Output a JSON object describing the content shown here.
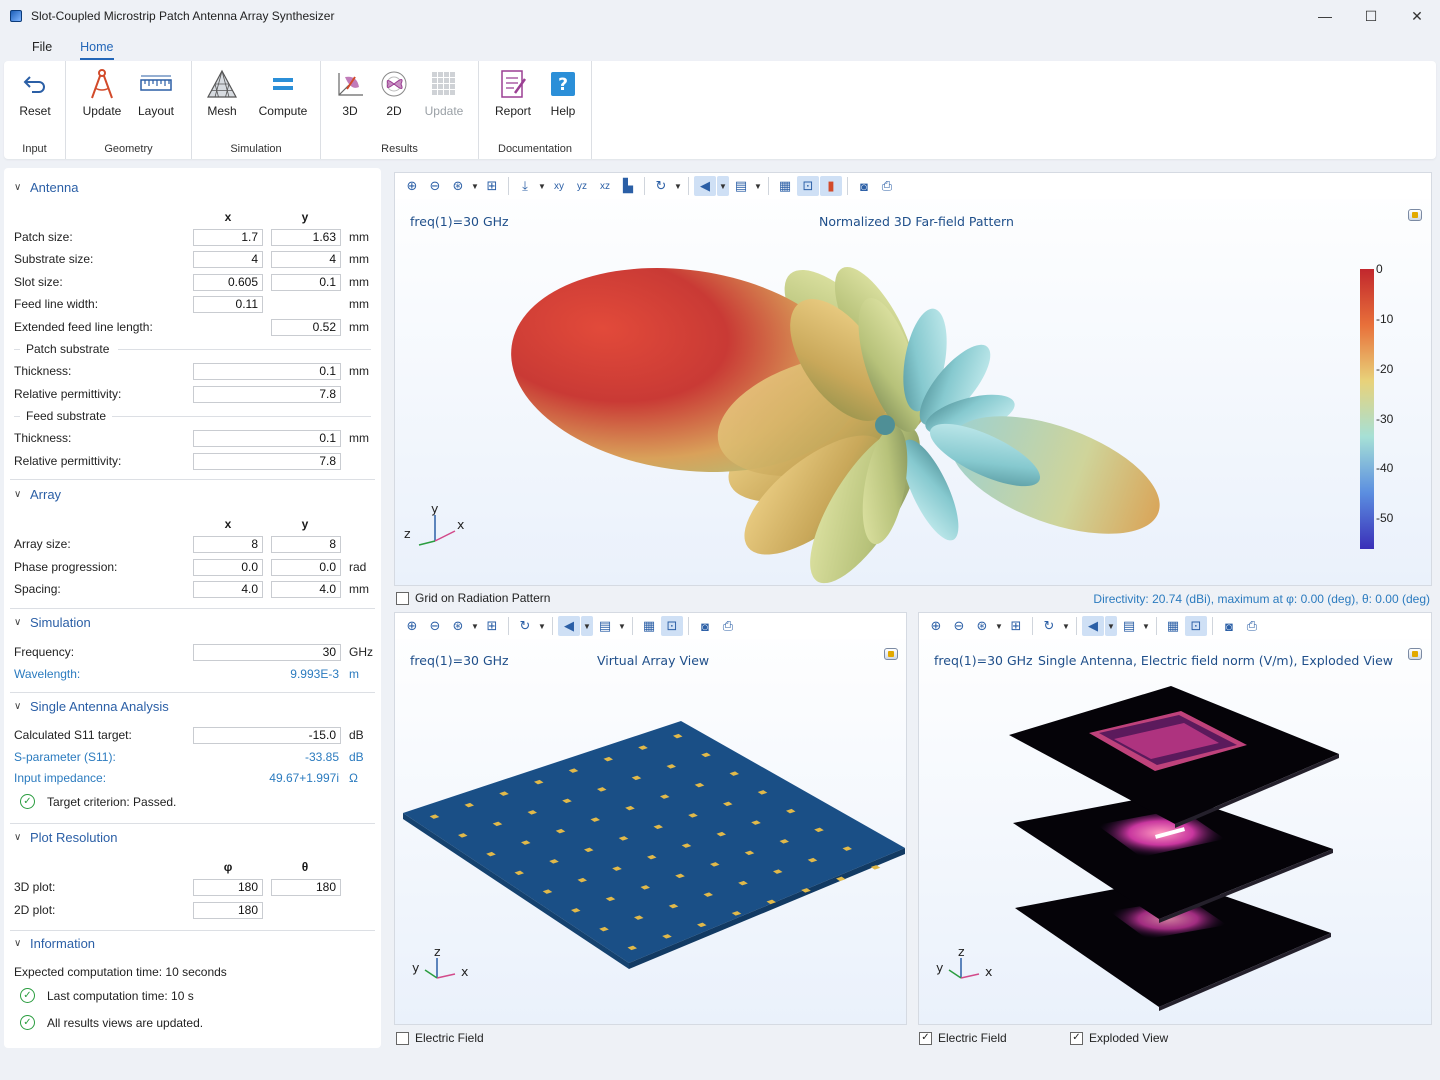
{
  "window": {
    "title": "Slot-Coupled Microstrip Patch Antenna Array Synthesizer",
    "minimize": "—",
    "maximize": "☐",
    "close": "✕"
  },
  "menu": {
    "tabs": [
      "File",
      "Home"
    ],
    "active": "Home"
  },
  "ribbon": {
    "groups": [
      {
        "label": "Input",
        "buttons": [
          "Reset"
        ]
      },
      {
        "label": "Geometry",
        "buttons": [
          "Update",
          "Layout"
        ]
      },
      {
        "label": "Simulation",
        "buttons": [
          "Mesh",
          "Compute"
        ]
      },
      {
        "label": "Results",
        "buttons": [
          "3D",
          "2D",
          "Update"
        ]
      },
      {
        "label": "Documentation",
        "buttons": [
          "Report",
          "Help"
        ]
      }
    ]
  },
  "antenna": {
    "title": "Antenna",
    "col_x": "x",
    "col_y": "y",
    "patch_size": {
      "label": "Patch size:",
      "x": "1.7",
      "y": "1.63",
      "unit": "mm"
    },
    "substrate_size": {
      "label": "Substrate size:",
      "x": "4",
      "y": "4",
      "unit": "mm"
    },
    "slot_size": {
      "label": "Slot size:",
      "x": "0.605",
      "y": "0.1",
      "unit": "mm"
    },
    "feed_width": {
      "label": "Feed line width:",
      "x": "0.11",
      "unit": "mm"
    },
    "ext_feed": {
      "label": "Extended feed line length:",
      "y": "0.52",
      "unit": "mm"
    },
    "patch_substrate": {
      "title": "Patch substrate",
      "thickness": {
        "label": "Thickness:",
        "value": "0.1",
        "unit": "mm"
      },
      "permittivity": {
        "label": "Relative permittivity:",
        "value": "7.8"
      }
    },
    "feed_substrate": {
      "title": "Feed substrate",
      "thickness": {
        "label": "Thickness:",
        "value": "0.1",
        "unit": "mm"
      },
      "permittivity": {
        "label": "Relative permittivity:",
        "value": "7.8"
      }
    }
  },
  "array": {
    "title": "Array",
    "col_x": "x",
    "col_y": "y",
    "size": {
      "label": "Array size:",
      "x": "8",
      "y": "8"
    },
    "phase": {
      "label": "Phase progression:",
      "x": "0.0",
      "y": "0.0",
      "unit": "rad"
    },
    "spacing": {
      "label": "Spacing:",
      "x": "4.0",
      "y": "4.0",
      "unit": "mm"
    }
  },
  "simulation": {
    "title": "Simulation",
    "frequency": {
      "label": "Frequency:",
      "value": "30",
      "unit": "GHz"
    },
    "wavelength": {
      "label": "Wavelength:",
      "value": "9.993E-3",
      "unit": "m"
    }
  },
  "single": {
    "title": "Single Antenna Analysis",
    "s11_target": {
      "label": "Calculated S11 target:",
      "value": "-15.0",
      "unit": "dB"
    },
    "sparam": {
      "label": "S-parameter (S11):",
      "value": "-33.85",
      "unit": "dB"
    },
    "impedance": {
      "label": "Input impedance:",
      "value": "49.67+1.997i",
      "unit": "Ω"
    },
    "criterion": "Target criterion: Passed."
  },
  "plotres": {
    "title": "Plot Resolution",
    "col_phi": "φ",
    "col_theta": "θ",
    "plot3d": {
      "label": "3D plot:",
      "phi": "180",
      "theta": "180"
    },
    "plot2d": {
      "label": "2D plot:",
      "phi": "180"
    }
  },
  "info": {
    "title": "Information",
    "expected": "Expected computation time: 10 seconds",
    "last": "Last computation time: 10 s",
    "updated": "All results views are updated."
  },
  "view3d": {
    "freq": "freq(1)=30 GHz",
    "title": "Normalized 3D Far-field Pattern",
    "colorbar_ticks": [
      "0",
      "-10",
      "-20",
      "-30",
      "-40",
      "-50"
    ],
    "grid_checkbox": "Grid on Radiation Pattern",
    "grid_checked": false,
    "directivity": "Directivity: 20.74 (dBi), maximum at φ: 0.00 (deg), θ: 0.00 (deg)",
    "axes": {
      "x": "x",
      "y": "y",
      "z": "z"
    }
  },
  "viewArray": {
    "freq": "freq(1)=30 GHz",
    "title": "Virtual Array View",
    "checkbox": "Electric Field",
    "checked": false,
    "axes": {
      "x": "x",
      "y": "y",
      "z": "z"
    }
  },
  "viewSingle": {
    "freq": "freq(1)=30 GHz",
    "title": "Single Antenna, Electric field norm (V/m), Exploded View",
    "checkbox1": "Electric Field",
    "checkbox1_checked": true,
    "checkbox2": "Exploded View",
    "checkbox2_checked": true,
    "axes": {
      "x": "x",
      "y": "y",
      "z": "z"
    }
  }
}
